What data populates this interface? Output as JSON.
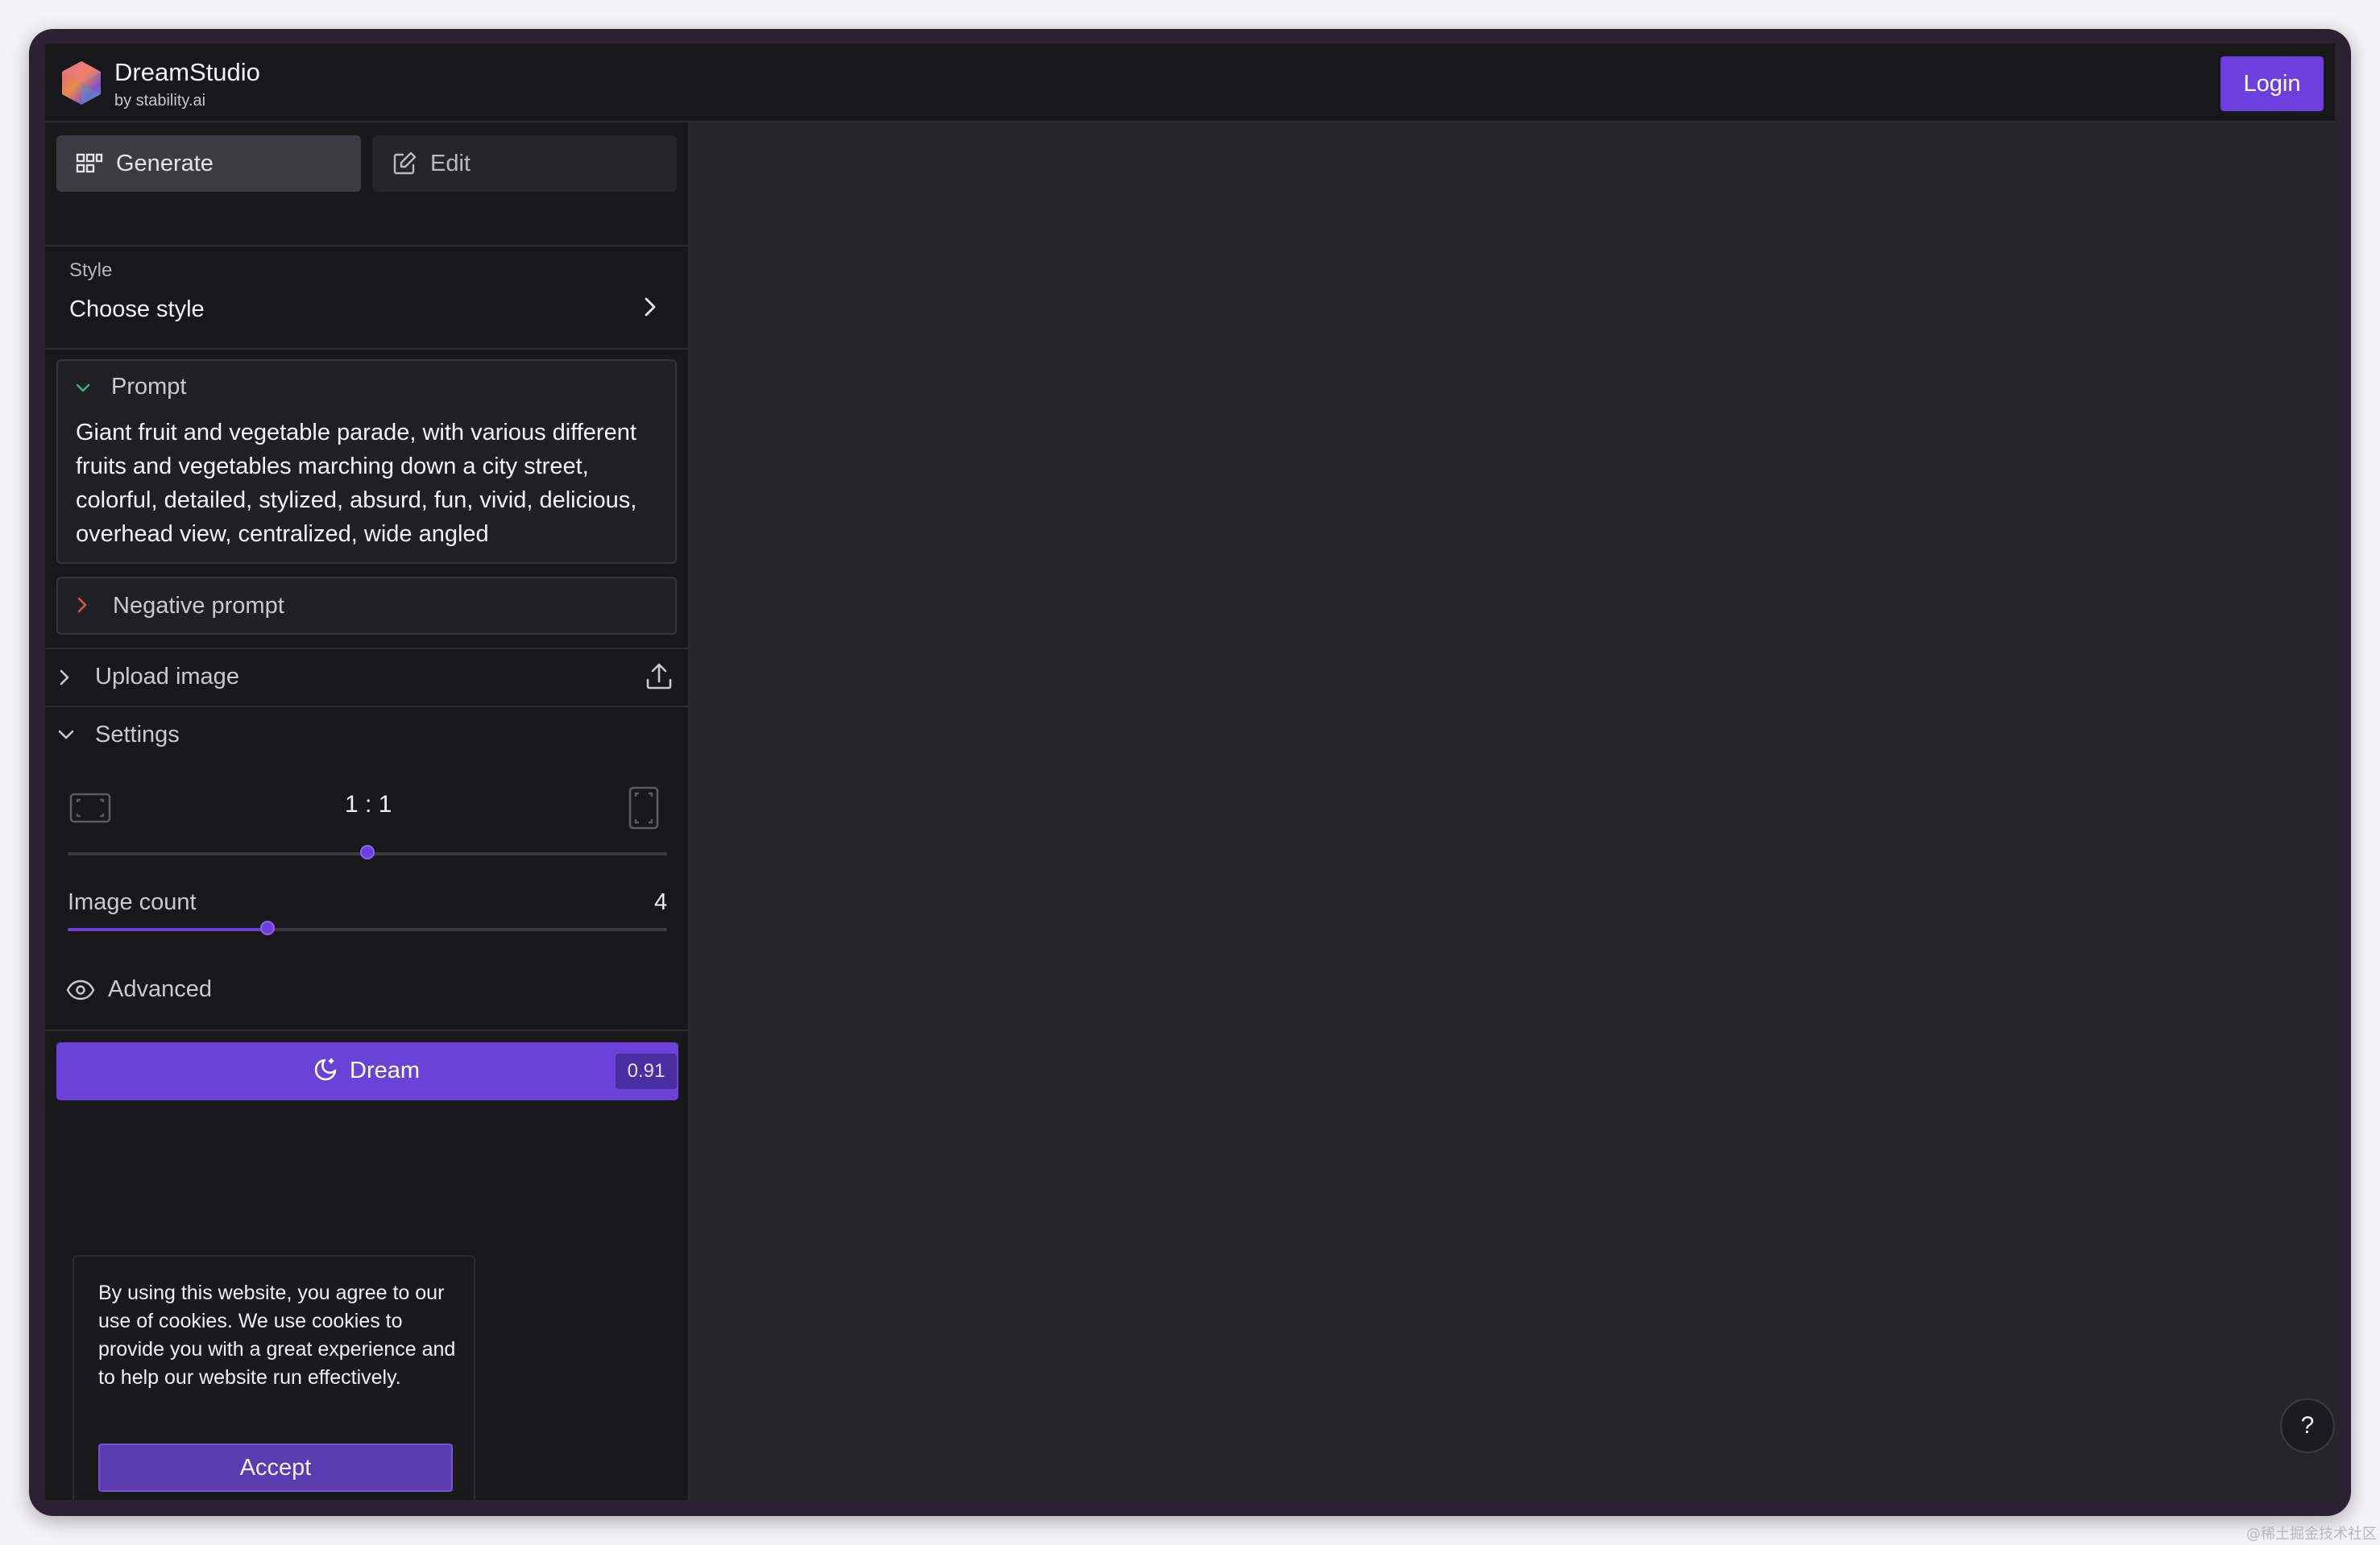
{
  "header": {
    "brand_title": "DreamStudio",
    "brand_subtitle": "by stability.ai",
    "login_label": "Login"
  },
  "tabs": {
    "generate_label": "Generate",
    "edit_label": "Edit"
  },
  "style": {
    "label": "Style",
    "value": "Choose style"
  },
  "prompt": {
    "title": "Prompt",
    "text": "Giant fruit and vegetable parade, with various different fruits and vegetables marching down a city street, colorful, detailed, stylized, absurd, fun, vivid, delicious, overhead view, centralized, wide angled"
  },
  "negative_prompt": {
    "title": "Negative prompt"
  },
  "upload": {
    "label": "Upload image"
  },
  "settings": {
    "title": "Settings",
    "aspect_ratio": "1 : 1",
    "aspect_ratio_slider_fraction": 0.5,
    "image_count_label": "Image count",
    "image_count_value": "4",
    "image_count_min": 1,
    "image_count_max": 10,
    "advanced_label": "Advanced"
  },
  "dream": {
    "label": "Dream",
    "cost": "0.91"
  },
  "cookie": {
    "text": "By using this website, you agree to our use of cookies. We use cookies to provide you with a great experience and to help our website run effectively.",
    "accept_label": "Accept"
  },
  "help": {
    "label": "?"
  },
  "watermark": "@稀土掘金技术社区",
  "colors": {
    "accent": "#6d3fde",
    "panel_bg": "#18181b",
    "canvas_bg": "#262629"
  }
}
